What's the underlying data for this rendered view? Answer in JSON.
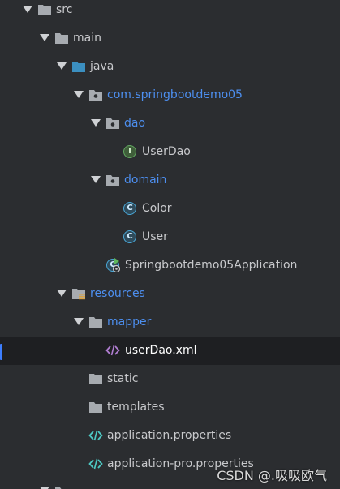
{
  "tree": {
    "src": "src",
    "main": "main",
    "java": "java",
    "package": "com.springbootdemo05",
    "dao": "dao",
    "user_dao": "UserDao",
    "domain": "domain",
    "color": "Color",
    "user": "User",
    "application_class": "Springbootdemo05Application",
    "resources": "resources",
    "mapper": "mapper",
    "user_dao_xml": "userDao.xml",
    "static": "static",
    "templates": "templates",
    "application_properties": "application.properties",
    "application_pro_properties": "application-pro.properties"
  },
  "watermark": "CSDN @.吸吸欧气",
  "colors": {
    "background": "#2b2d30",
    "selected_row": "#1e1f22",
    "selection_marker": "#3d7eff",
    "package_text": "#4d8ff0",
    "folder_icon": "#a7abb0",
    "java_folder_icon": "#3b8fc0",
    "interface_icon": "#62a861",
    "class_icon": "#4aa8d8",
    "xml_icon": "#b07dd1",
    "properties_icon": "#4ec9c4"
  },
  "icons": {
    "expand": "chevron-down-icon",
    "folder": "folder-icon",
    "source_folder": "source-folder-icon",
    "package": "package-icon",
    "resources_folder": "resources-folder-icon",
    "interface": "interface-icon",
    "class": "class-icon",
    "application": "spring-application-icon",
    "xml": "xml-file-icon",
    "properties": "properties-file-icon"
  }
}
